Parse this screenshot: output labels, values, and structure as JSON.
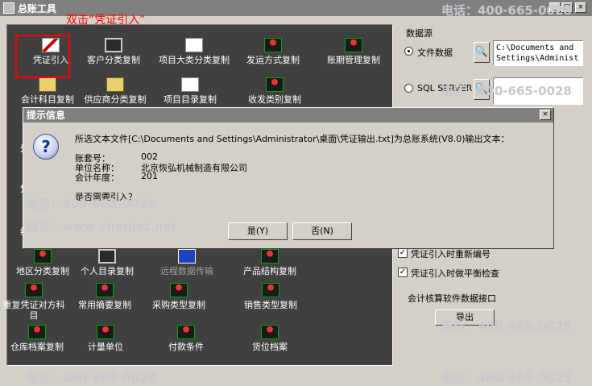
{
  "window": {
    "title": "总账工具",
    "btn_min": "_",
    "btn_max": "□",
    "btn_close": "×"
  },
  "annotation": "双击“凭证引入”",
  "tools": [
    {
      "label": "凭证引入",
      "icon": "pen-icon"
    },
    {
      "label": "客户分类复制",
      "icon": "book-icon"
    },
    {
      "label": "项目大类分类复制",
      "icon": "network-icon"
    },
    {
      "label": "发运方式复制",
      "icon": "rider-icon"
    },
    {
      "label": "账期管理复制",
      "icon": "rider-icon"
    },
    {
      "label": "会计科目复制",
      "icon": "folder-icon"
    },
    {
      "label": "供应商分类复制",
      "icon": "people-icon"
    },
    {
      "label": "项目目录复制",
      "icon": "doc-icon"
    },
    {
      "label": "收发类别复制",
      "icon": "rider-icon"
    },
    {
      "label": "地区分类复制",
      "icon": "map-icon"
    },
    {
      "label": "个人目录复制",
      "icon": "person-icon"
    },
    {
      "label": "远程数据传输",
      "icon": "computer-icon"
    },
    {
      "label": "产品结构复制",
      "icon": "rider-icon"
    },
    {
      "label": "重复凭证对方科目",
      "icon": "rider-icon"
    },
    {
      "label": "常用摘要复制",
      "icon": "rider-icon"
    },
    {
      "label": "采购类型复制",
      "icon": "rider-icon"
    },
    {
      "label": "销售类型复制",
      "icon": "rider-icon"
    },
    {
      "label": "仓库档案复制",
      "icon": "rider-icon"
    },
    {
      "label": "计量单位",
      "icon": "rider-icon"
    },
    {
      "label": "付款条件",
      "icon": "rider-icon"
    },
    {
      "label": "货位档案",
      "icon": "rider-icon"
    }
  ],
  "side_partial": [
    "外",
    "凭",
    "结"
  ],
  "datasource": {
    "title": "数据源",
    "file_label": "文件数据",
    "file_path": "C:\\Documents and\nSettings\\Administ",
    "sql_label": "SQL SERVER",
    "check_renumber": "凭证引入时重新编号",
    "check_balance": "凭证引入时做平衡检查",
    "interface_title": "会计核算软件数据接口",
    "export_label": "导出"
  },
  "dialog": {
    "title": "提示信息",
    "message": "所选文本文件[C:\\Documents and Settings\\Administrator\\桌面\\凭证输出.txt]为总账系统(V8.0)输出文本：",
    "account_label": "账套号：",
    "account_value": "002",
    "unit_label": "单位名称：",
    "unit_value": "北京恢弘机械制造有限公司",
    "year_label": "会计年度：",
    "year_value": "201",
    "question": "是否需要引入？",
    "yes_label": "是(Y)",
    "no_label": "否(N)",
    "close": "×"
  },
  "watermarks": {
    "phone": "电话：400-665-0028",
    "web": "网址：www.chanjet.net"
  }
}
